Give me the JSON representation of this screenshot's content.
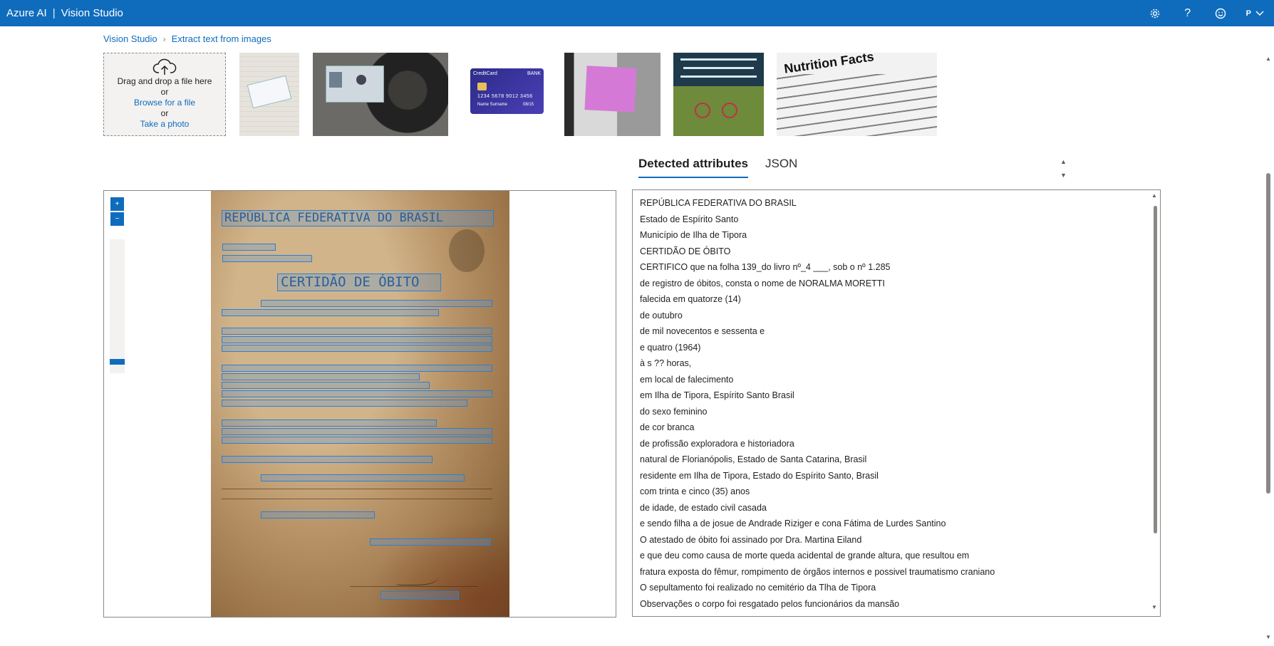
{
  "header": {
    "brand": "Azure AI",
    "separator": "|",
    "product": "Vision Studio",
    "icons": [
      "settings-icon",
      "help-icon",
      "feedback-icon"
    ],
    "avatar_initial": "P"
  },
  "breadcrumb": {
    "root": "Vision Studio",
    "current": "Extract text from images"
  },
  "upload": {
    "line1": "Drag and drop a file here",
    "or1": "or",
    "browse": "Browse for a file",
    "or2": "or",
    "photo": "Take a photo"
  },
  "samples": {
    "card_brand": "CreditCard",
    "card_bank": "BANK",
    "card_number": "1234 5678 9012 3456",
    "card_name": "Name Surname",
    "card_exp": "08/15",
    "nutrition_title": "Nutrition Facts"
  },
  "tabs": {
    "detected": "Detected attributes",
    "json": "JSON"
  },
  "document": {
    "title": "REPÚBLICA FEDERATIVA DO BRASIL",
    "heading": "CERTIDÃO DE ÓBITO"
  },
  "results": {
    "lines": [
      "REPÚBLICA FEDERATIVA DO BRASIL",
      "Estado de Espírito Santo",
      "Município de Ilha de Tipora",
      "CERTIDÃO DE ÓBITO",
      "CERTIFICO que na folha 139_do livro nº_4 ___, sob o nº 1.285",
      "de registro de óbitos, consta o nome de NORALMA MORETTI",
      "falecida em quatorze (14)",
      "de outubro",
      "de mil novecentos e sessenta e",
      "e quatro (1964)",
      "à s ?? horas,",
      "em local de falecimento",
      "em Ilha de Tipora, Espírito Santo Brasil",
      "do sexo feminino",
      "de cor branca",
      "de profissão exploradora e historiadora",
      "natural de Florianópolis, Estado de Santa Catarina, Brasil",
      "residente em Ilha de Tipora, Estado do Espírito Santo, Brasil",
      "com trinta e cinco (35) anos",
      "de idade, de estado civil casada",
      "e sendo filha a de josue de Andrade Riziger e cona Fátima de Lurdes Santino",
      "O atestado de óbito foi assinado por Dra. Martina Eiland",
      "e que deu como causa de morte queda acidental de grande altura, que resultou em",
      "fratura exposta do fêmur, rompimento de órgãos internos e possivel traumatismo craniano",
      "O sepultamento foi realizado no cemitério da Tlha de Tipora",
      "Observações o corpo foi resgatado pelos funcionários da mansão"
    ]
  },
  "colors": {
    "accent": "#0f6cbd",
    "box": "#2f7fd0"
  }
}
